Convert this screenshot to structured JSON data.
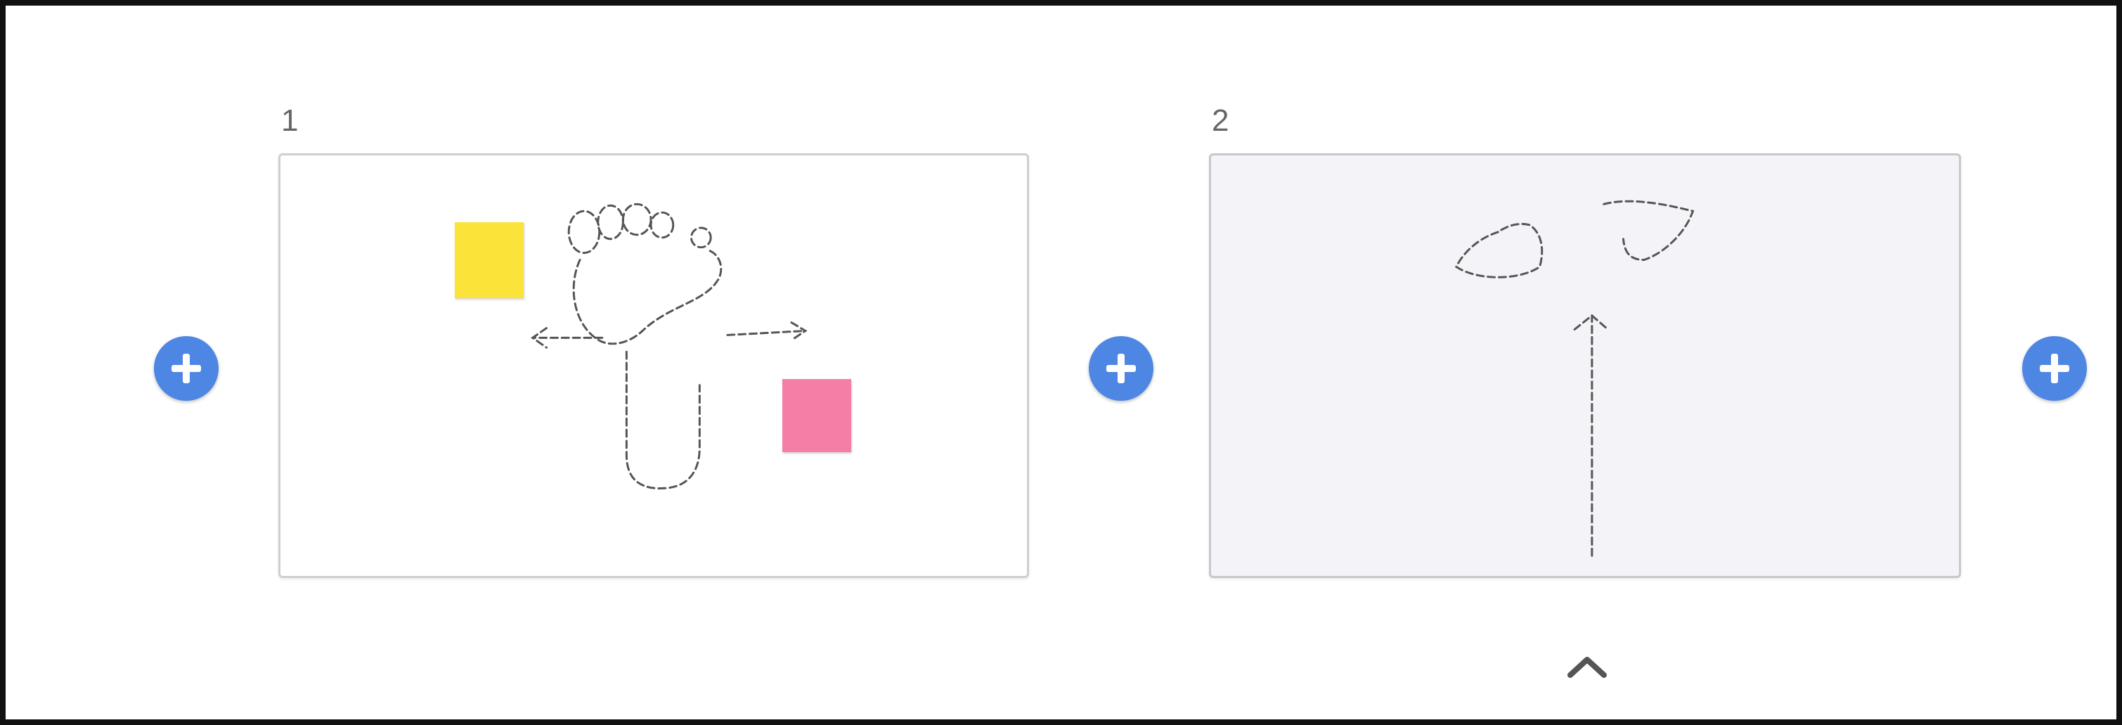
{
  "frames": [
    {
      "number": "1",
      "stickies": [
        {
          "text": "",
          "color": "#fbe33a"
        },
        {
          "text": "",
          "color": "#f57ea6"
        }
      ]
    },
    {
      "number": "2"
    }
  ],
  "colors": {
    "add_button": "#4e86e4",
    "chevron": "#555555",
    "sketch_stroke": "#555555"
  },
  "icons": {
    "add": "plus-circle-icon",
    "collapse": "chevron-up-icon"
  }
}
